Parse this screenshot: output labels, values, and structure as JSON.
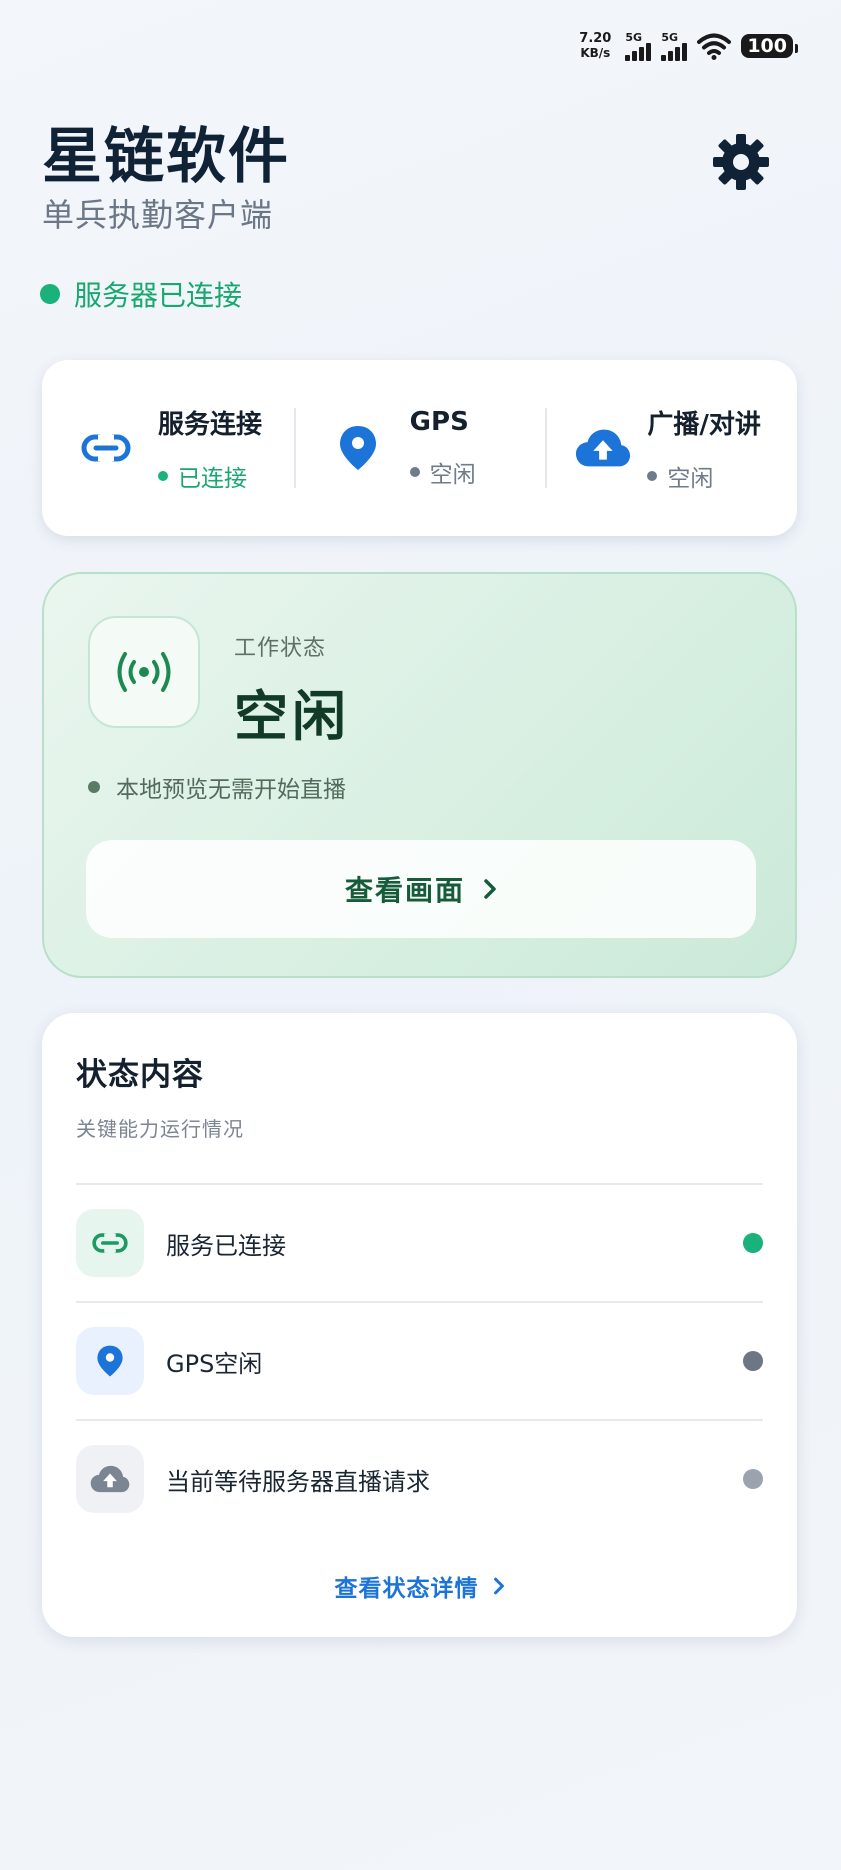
{
  "status_bar": {
    "speed_value": "7.20",
    "speed_unit": "KB/s",
    "sim1_label": "5G",
    "sim2_label": "5G",
    "battery": "100"
  },
  "header": {
    "title": "星链软件",
    "subtitle": "单兵执勤客户端",
    "connection_text": "服务器已连接"
  },
  "quick_status": [
    {
      "title": "服务连接",
      "state": "已连接",
      "state_color": "#18b27a",
      "icon": "link-icon"
    },
    {
      "title": "GPS",
      "state": "空闲",
      "state_color": "#6f7b8a",
      "icon": "location-pin-icon"
    },
    {
      "title": "广播/对讲",
      "state": "空闲",
      "state_color": "#6f7b8a",
      "icon": "cloud-upload-icon"
    }
  ],
  "work_status": {
    "label": "工作状态",
    "value": "空闲",
    "note": "本地预览无需开始直播",
    "button_label": "查看画面",
    "icon": "broadcast-icon"
  },
  "status_content": {
    "title": "状态内容",
    "subtitle": "关键能力运行情况",
    "items": [
      {
        "label": "服务已连接",
        "dot_color": "#18b27a",
        "icon": "link-icon"
      },
      {
        "label": "GPS空闲",
        "dot_color": "#6d7684",
        "icon": "location-pin-icon"
      },
      {
        "label": "当前等待服务器直播请求",
        "dot_color": "#9aa3af",
        "icon": "cloud-upload-icon"
      }
    ],
    "detail_link": "查看状态详情"
  },
  "colors": {
    "accent_green": "#18b27a",
    "accent_blue": "#1d74d8",
    "title_dark": "#0f2236"
  }
}
